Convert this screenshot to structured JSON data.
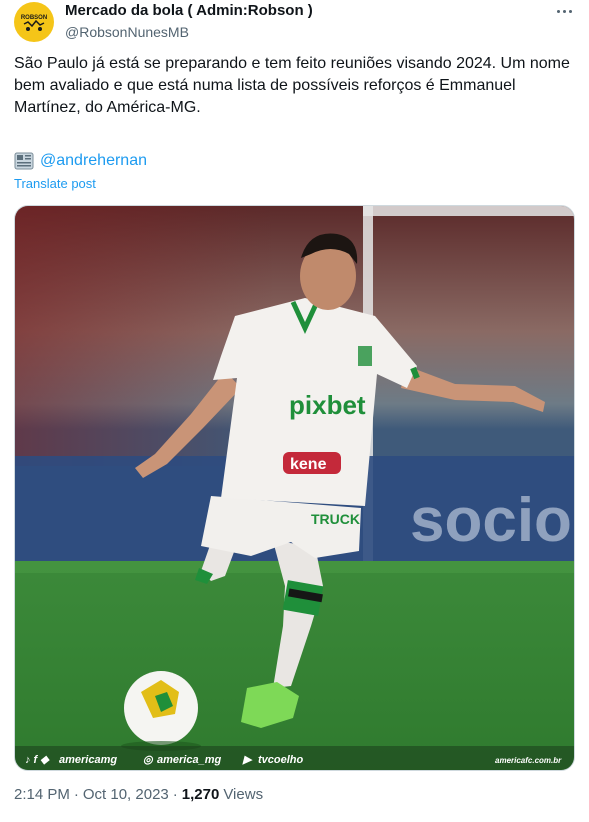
{
  "author": {
    "display_name": "Mercado da bola ( Admin:Robson )",
    "handle": "@RobsonNunesMB",
    "avatar_text": "ROBSON"
  },
  "tweet": {
    "text": "São Paulo já está se preparando e tem feito reuniões visando 2024. Um nome bem avaliado e que está numa lista de possíveis reforços é Emmanuel Martínez, do América-MG.",
    "mention": "@andrehernan",
    "translate_label": "Translate post"
  },
  "media": {
    "jersey_sponsor": "pixbet",
    "jersey_partner": "kene",
    "shorts_text": "TRUCK",
    "footer_social": [
      "americamg",
      "america_mg",
      "tvcoelho"
    ],
    "footer_site": "americafc.com.br",
    "brand_green": "#1f8f3a"
  },
  "meta": {
    "time": "2:14 PM",
    "separator": "·",
    "date": "Oct 10, 2023",
    "views_count": "1,270",
    "views_label": "Views"
  },
  "colors": {
    "link": "#1d9bf0",
    "secondary_text": "#536471",
    "avatar_bg": "#f5c518"
  }
}
